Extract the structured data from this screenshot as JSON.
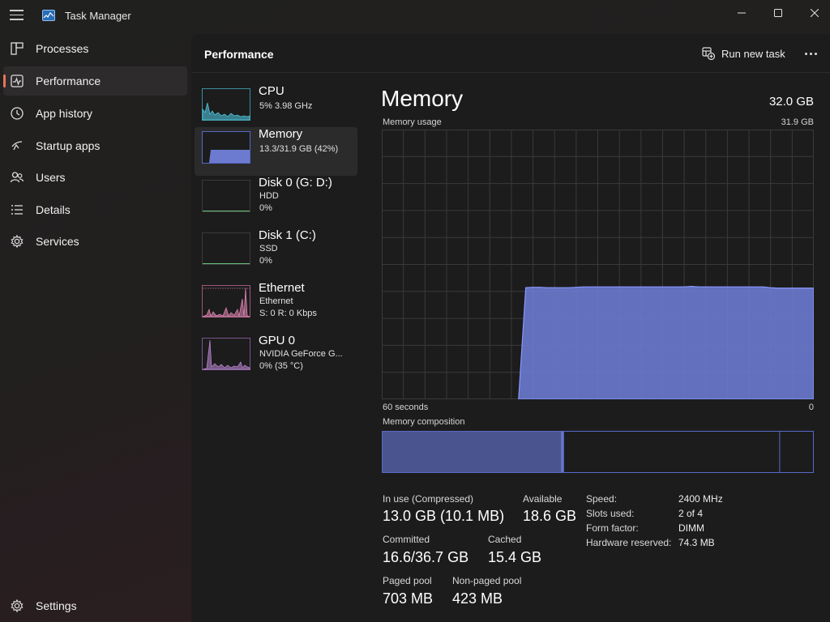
{
  "app": {
    "title": "Task Manager"
  },
  "sidebar": {
    "items": [
      {
        "label": "Processes",
        "icon": "processes-icon"
      },
      {
        "label": "Performance",
        "icon": "performance-icon",
        "active": true
      },
      {
        "label": "App history",
        "icon": "app-history-icon"
      },
      {
        "label": "Startup apps",
        "icon": "startup-apps-icon"
      },
      {
        "label": "Users",
        "icon": "users-icon"
      },
      {
        "label": "Details",
        "icon": "details-icon"
      },
      {
        "label": "Services",
        "icon": "services-icon"
      }
    ],
    "settings_label": "Settings"
  },
  "header": {
    "title": "Performance",
    "run_new_task": "Run new task"
  },
  "devices": [
    {
      "name": "CPU",
      "line1": "5% 3.98 GHz",
      "line2": "",
      "color": "#4cc2d9"
    },
    {
      "name": "Memory",
      "line1": "13.3/31.9 GB (42%)",
      "line2": "",
      "color": "#7a8cf0",
      "active": true
    },
    {
      "name": "Disk 0 (G: D:)",
      "line1": "HDD",
      "line2": "0%",
      "color": "#6bbf7a"
    },
    {
      "name": "Disk 1 (C:)",
      "line1": "SSD",
      "line2": "0%",
      "color": "#6bbf7a"
    },
    {
      "name": "Ethernet",
      "line1": "Ethernet",
      "line2": "S: 0 R: 0 Kbps",
      "color": "#e88ab8"
    },
    {
      "name": "GPU 0",
      "line1": "NVIDIA GeForce G...",
      "line2": "0% (35 °C)",
      "color": "#c08ad8"
    }
  ],
  "detail": {
    "title": "Memory",
    "total": "32.0 GB",
    "usage_label": "Memory usage",
    "usage_max": "31.9 GB",
    "axis_left": "60 seconds",
    "axis_right": "0",
    "composition_label": "Memory composition",
    "composition": {
      "in_use_fraction": 0.415,
      "modified_fraction": 0.006,
      "standby_fraction": 0.5,
      "free_fraction": 0.079
    },
    "usage_series_gb": [
      0,
      0,
      0,
      0,
      0,
      0,
      0,
      0,
      0,
      0,
      0,
      0,
      0,
      0,
      0,
      0,
      0,
      0,
      0,
      0,
      13.2,
      13.25,
      13.25,
      13.2,
      13.2,
      13.2,
      13.2,
      13.25,
      13.3,
      13.3,
      13.3,
      13.3,
      13.3,
      13.3,
      13.3,
      13.3,
      13.3,
      13.3,
      13.3,
      13.3,
      13.3,
      13.3,
      13.3,
      13.35,
      13.3,
      13.3,
      13.3,
      13.3,
      13.3,
      13.3,
      13.3,
      13.3,
      13.3,
      13.3,
      13.2,
      13.15,
      13.15,
      13.15,
      13.15,
      13.15,
      13.15
    ],
    "usage_ymax_gb": 31.9,
    "colors": {
      "fill": "#6f7fd9",
      "stroke": "#8a99ff",
      "grid": "#3a3a3a",
      "frame": "#5868c8"
    }
  },
  "stats": {
    "in_use_label": "In use (Compressed)",
    "in_use_value": "13.0 GB (10.1 MB)",
    "available_label": "Available",
    "available_value": "18.6 GB",
    "committed_label": "Committed",
    "committed_value": "16.6/36.7 GB",
    "cached_label": "Cached",
    "cached_value": "15.4 GB",
    "paged_label": "Paged pool",
    "paged_value": "703 MB",
    "nonpaged_label": "Non-paged pool",
    "nonpaged_value": "423 MB"
  },
  "specs": [
    {
      "key": "Speed:",
      "value": "2400 MHz"
    },
    {
      "key": "Slots used:",
      "value": "2 of 4"
    },
    {
      "key": "Form factor:",
      "value": "DIMM"
    },
    {
      "key": "Hardware reserved:",
      "value": "74.3 MB"
    }
  ]
}
